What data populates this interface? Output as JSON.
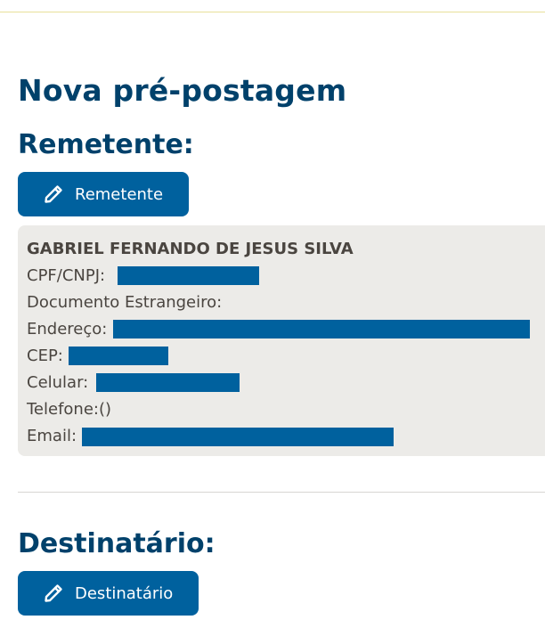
{
  "page": {
    "title": "Nova pré-postagem"
  },
  "sender": {
    "section_title": "Remetente:",
    "button_label": "Remetente",
    "name": "GABRIEL FERNANDO DE JESUS SILVA",
    "fields": {
      "cpf_label": "CPF/CNPJ:",
      "foreign_doc_label": "Documento Estrangeiro:",
      "address_label": "Endereço:",
      "cep_label": "CEP:",
      "mobile_label": "Celular:",
      "phone_label": "Telefone:()",
      "email_label": "Email:"
    }
  },
  "recipient": {
    "section_title": "Destinatário:",
    "button_label": "Destinatário"
  },
  "colors": {
    "brand_blue": "#00619e",
    "title_blue": "#00416b",
    "card_bg": "#ecebe8"
  },
  "icons": {
    "edit": "pencil-icon"
  }
}
